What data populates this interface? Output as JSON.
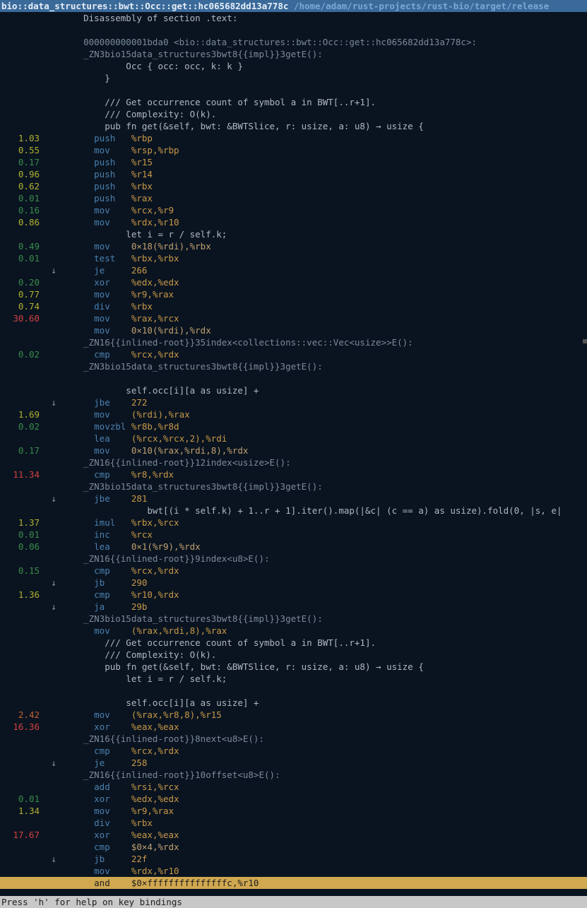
{
  "titlebar": {
    "func": "bio::data_structures::bwt::Occ::get::hc065682dd13a778c",
    "path": "/home/adam/rust-projects/rust-bio/target/release"
  },
  "statusbar": "Press 'h' for help on key bindings",
  "lines": [
    {
      "p": "",
      "j": "",
      "hl": false,
      "segs": [
        {
          "c": "src",
          "t": "    Disassembly of section .text:"
        }
      ]
    },
    {
      "p": "",
      "j": "",
      "hl": false,
      "segs": [
        {
          "c": "src",
          "t": ""
        }
      ]
    },
    {
      "p": "",
      "j": "",
      "hl": false,
      "segs": [
        {
          "c": "lbl",
          "t": "    000000000001bda0 <bio::data_structures::bwt::Occ::get::hc065682dd13a778c>:"
        }
      ]
    },
    {
      "p": "",
      "j": "",
      "hl": false,
      "segs": [
        {
          "c": "lbl",
          "t": "    _ZN3bio15data_structures3bwt8{{impl}}3getE():"
        }
      ]
    },
    {
      "p": "",
      "j": "",
      "hl": false,
      "segs": [
        {
          "c": "src",
          "t": "            Occ { occ: occ, k: k }"
        }
      ]
    },
    {
      "p": "",
      "j": "",
      "hl": false,
      "segs": [
        {
          "c": "src",
          "t": "        }"
        }
      ]
    },
    {
      "p": "",
      "j": "",
      "hl": false,
      "segs": [
        {
          "c": "src",
          "t": ""
        }
      ]
    },
    {
      "p": "",
      "j": "",
      "hl": false,
      "segs": [
        {
          "c": "src",
          "t": "        /// Get occurrence count of symbol a in BWT[..r+1]."
        }
      ]
    },
    {
      "p": "",
      "j": "",
      "hl": false,
      "segs": [
        {
          "c": "src",
          "t": "        /// Complexity: O(k)."
        }
      ]
    },
    {
      "p": "",
      "j": "",
      "hl": false,
      "segs": [
        {
          "c": "src",
          "t": "        pub fn get(&self, bwt: &BWTSlice, r: usize, a: u8) → usize {"
        }
      ]
    },
    {
      "p": "1.03",
      "pc": "pct-med",
      "j": "",
      "hl": false,
      "segs": [
        {
          "c": "mnem",
          "t": "      push   "
        },
        {
          "c": "reg",
          "t": "%rbp"
        }
      ]
    },
    {
      "p": "0.55",
      "pc": "pct-med",
      "j": "",
      "hl": false,
      "segs": [
        {
          "c": "mnem",
          "t": "      mov    "
        },
        {
          "c": "reg",
          "t": "%rsp,%rbp"
        }
      ]
    },
    {
      "p": "0.17",
      "pc": "pct-low",
      "j": "",
      "hl": false,
      "segs": [
        {
          "c": "mnem",
          "t": "      push   "
        },
        {
          "c": "reg",
          "t": "%r15"
        }
      ]
    },
    {
      "p": "0.96",
      "pc": "pct-med",
      "j": "",
      "hl": false,
      "segs": [
        {
          "c": "mnem",
          "t": "      push   "
        },
        {
          "c": "reg",
          "t": "%r14"
        }
      ]
    },
    {
      "p": "0.62",
      "pc": "pct-med",
      "j": "",
      "hl": false,
      "segs": [
        {
          "c": "mnem",
          "t": "      push   "
        },
        {
          "c": "reg",
          "t": "%rbx"
        }
      ]
    },
    {
      "p": "0.01",
      "pc": "pct-low",
      "j": "",
      "hl": false,
      "segs": [
        {
          "c": "mnem",
          "t": "      push   "
        },
        {
          "c": "reg",
          "t": "%rax"
        }
      ]
    },
    {
      "p": "0.16",
      "pc": "pct-low",
      "j": "",
      "hl": false,
      "segs": [
        {
          "c": "mnem",
          "t": "      mov    "
        },
        {
          "c": "reg",
          "t": "%rcx,%r9"
        }
      ]
    },
    {
      "p": "0.86",
      "pc": "pct-med",
      "j": "",
      "hl": false,
      "segs": [
        {
          "c": "mnem",
          "t": "      mov    "
        },
        {
          "c": "reg",
          "t": "%rdx,%r10"
        }
      ]
    },
    {
      "p": "",
      "j": "",
      "hl": false,
      "segs": [
        {
          "c": "src",
          "t": "            let i = r / self.k;"
        }
      ]
    },
    {
      "p": "0.49",
      "pc": "pct-low",
      "j": "",
      "hl": false,
      "segs": [
        {
          "c": "mnem",
          "t": "      mov    "
        },
        {
          "c": "num",
          "t": "0×18(%rdi),%rbx"
        }
      ]
    },
    {
      "p": "0.01",
      "pc": "pct-low",
      "j": "",
      "hl": false,
      "segs": [
        {
          "c": "mnem",
          "t": "      test   "
        },
        {
          "c": "reg",
          "t": "%rbx,%rbx"
        }
      ]
    },
    {
      "p": "",
      "j": "↓",
      "hl": false,
      "segs": [
        {
          "c": "mnem",
          "t": "      je     "
        },
        {
          "c": "tgt",
          "t": "266"
        }
      ]
    },
    {
      "p": "0.20",
      "pc": "pct-low",
      "j": "",
      "hl": false,
      "segs": [
        {
          "c": "mnem",
          "t": "      xor    "
        },
        {
          "c": "reg",
          "t": "%edx,%edx"
        }
      ]
    },
    {
      "p": "0.77",
      "pc": "pct-med",
      "j": "",
      "hl": false,
      "segs": [
        {
          "c": "mnem",
          "t": "      mov    "
        },
        {
          "c": "reg",
          "t": "%r9,%rax"
        }
      ]
    },
    {
      "p": "0.74",
      "pc": "pct-med",
      "j": "",
      "hl": false,
      "segs": [
        {
          "c": "mnem",
          "t": "      div    "
        },
        {
          "c": "reg",
          "t": "%rbx"
        }
      ]
    },
    {
      "p": "30.60",
      "pc": "pct-hot",
      "j": "",
      "hl": false,
      "segs": [
        {
          "c": "mnem",
          "t": "      mov    "
        },
        {
          "c": "reg",
          "t": "%rax,%rcx"
        }
      ]
    },
    {
      "p": "",
      "j": "",
      "hl": false,
      "segs": [
        {
          "c": "mnem",
          "t": "      mov    "
        },
        {
          "c": "num",
          "t": "0×10(%rdi),%rdx"
        }
      ]
    },
    {
      "p": "",
      "j": "",
      "hl": false,
      "segs": [
        {
          "c": "lbl",
          "t": "    _ZN16{{inlined-root}}35index<collections::vec::Vec<usize>>E():"
        }
      ]
    },
    {
      "p": "0.02",
      "pc": "pct-low",
      "j": "",
      "hl": false,
      "segs": [
        {
          "c": "mnem",
          "t": "      cmp    "
        },
        {
          "c": "reg",
          "t": "%rcx,%rdx"
        }
      ]
    },
    {
      "p": "",
      "j": "",
      "hl": false,
      "segs": [
        {
          "c": "lbl",
          "t": "    _ZN3bio15data_structures3bwt8{{impl}}3getE():"
        }
      ]
    },
    {
      "p": "",
      "j": "",
      "hl": false,
      "segs": [
        {
          "c": "src",
          "t": ""
        }
      ]
    },
    {
      "p": "",
      "j": "",
      "hl": false,
      "segs": [
        {
          "c": "src",
          "t": "            self.occ[i][a as usize] +"
        }
      ]
    },
    {
      "p": "",
      "j": "↓",
      "hl": false,
      "segs": [
        {
          "c": "mnem",
          "t": "      jbe    "
        },
        {
          "c": "tgt",
          "t": "272"
        }
      ]
    },
    {
      "p": "1.69",
      "pc": "pct-med",
      "j": "",
      "hl": false,
      "segs": [
        {
          "c": "mnem",
          "t": "      mov    "
        },
        {
          "c": "reg",
          "t": "(%rdi),%rax"
        }
      ]
    },
    {
      "p": "0.02",
      "pc": "pct-low",
      "j": "",
      "hl": false,
      "segs": [
        {
          "c": "mnem",
          "t": "      movzbl "
        },
        {
          "c": "reg",
          "t": "%r8b,%r8d"
        }
      ]
    },
    {
      "p": "",
      "j": "",
      "hl": false,
      "segs": [
        {
          "c": "mnem",
          "t": "      lea    "
        },
        {
          "c": "reg",
          "t": "(%rcx,%rcx,2),%rdi"
        }
      ]
    },
    {
      "p": "0.17",
      "pc": "pct-low",
      "j": "",
      "hl": false,
      "segs": [
        {
          "c": "mnem",
          "t": "      mov    "
        },
        {
          "c": "num",
          "t": "0×10(%rax,%rdi,8),%rdx"
        }
      ]
    },
    {
      "p": "",
      "j": "",
      "hl": false,
      "segs": [
        {
          "c": "lbl",
          "t": "    _ZN16{{inlined-root}}12index<usize>E():"
        }
      ]
    },
    {
      "p": "11.34",
      "pc": "pct-hot",
      "j": "",
      "hl": false,
      "segs": [
        {
          "c": "mnem",
          "t": "      cmp    "
        },
        {
          "c": "reg",
          "t": "%r8,%rdx"
        }
      ]
    },
    {
      "p": "",
      "j": "",
      "hl": false,
      "segs": [
        {
          "c": "lbl",
          "t": "    _ZN3bio15data_structures3bwt8{{impl}}3getE():"
        }
      ]
    },
    {
      "p": "",
      "j": "↓",
      "hl": false,
      "segs": [
        {
          "c": "mnem",
          "t": "      jbe    "
        },
        {
          "c": "tgt",
          "t": "281"
        }
      ]
    },
    {
      "p": "",
      "j": "",
      "hl": false,
      "segs": [
        {
          "c": "src",
          "t": "                bwt[(i * self.k) + 1..r + 1].iter().map(|&c| (c == a) as usize).fold(0, |s, e|"
        }
      ]
    },
    {
      "p": "1.37",
      "pc": "pct-med",
      "j": "",
      "hl": false,
      "segs": [
        {
          "c": "mnem",
          "t": "      imul   "
        },
        {
          "c": "reg",
          "t": "%rbx,%rcx"
        }
      ]
    },
    {
      "p": "0.01",
      "pc": "pct-low",
      "j": "",
      "hl": false,
      "segs": [
        {
          "c": "mnem",
          "t": "      inc    "
        },
        {
          "c": "reg",
          "t": "%rcx"
        }
      ]
    },
    {
      "p": "0.06",
      "pc": "pct-low",
      "j": "",
      "hl": false,
      "segs": [
        {
          "c": "mnem",
          "t": "      lea    "
        },
        {
          "c": "num",
          "t": "0×1(%r9),%rdx"
        }
      ]
    },
    {
      "p": "",
      "j": "",
      "hl": false,
      "segs": [
        {
          "c": "lbl",
          "t": "    _ZN16{{inlined-root}}9index<u8>E():"
        }
      ]
    },
    {
      "p": "0.15",
      "pc": "pct-low",
      "j": "",
      "hl": false,
      "segs": [
        {
          "c": "mnem",
          "t": "      cmp    "
        },
        {
          "c": "reg",
          "t": "%rcx,%rdx"
        }
      ]
    },
    {
      "p": "",
      "j": "↓",
      "hl": false,
      "segs": [
        {
          "c": "mnem",
          "t": "      jb     "
        },
        {
          "c": "tgt",
          "t": "290"
        }
      ]
    },
    {
      "p": "1.36",
      "pc": "pct-med",
      "j": "",
      "hl": false,
      "segs": [
        {
          "c": "mnem",
          "t": "      cmp    "
        },
        {
          "c": "reg",
          "t": "%r10,%rdx"
        }
      ]
    },
    {
      "p": "",
      "j": "↓",
      "hl": false,
      "segs": [
        {
          "c": "mnem",
          "t": "      ja     "
        },
        {
          "c": "tgt",
          "t": "29b"
        }
      ]
    },
    {
      "p": "",
      "j": "",
      "hl": false,
      "segs": [
        {
          "c": "lbl",
          "t": "    _ZN3bio15data_structures3bwt8{{impl}}3getE():"
        }
      ]
    },
    {
      "p": "",
      "j": "",
      "hl": false,
      "segs": [
        {
          "c": "mnem",
          "t": "      mov    "
        },
        {
          "c": "reg",
          "t": "(%rax,%rdi,8),%rax"
        }
      ]
    },
    {
      "p": "",
      "j": "",
      "hl": false,
      "segs": [
        {
          "c": "src",
          "t": "        /// Get occurrence count of symbol a in BWT[..r+1]."
        }
      ]
    },
    {
      "p": "",
      "j": "",
      "hl": false,
      "segs": [
        {
          "c": "src",
          "t": "        /// Complexity: O(k)."
        }
      ]
    },
    {
      "p": "",
      "j": "",
      "hl": false,
      "segs": [
        {
          "c": "src",
          "t": "        pub fn get(&self, bwt: &BWTSlice, r: usize, a: u8) → usize {"
        }
      ]
    },
    {
      "p": "",
      "j": "",
      "hl": false,
      "segs": [
        {
          "c": "src",
          "t": "            let i = r / self.k;"
        }
      ]
    },
    {
      "p": "",
      "j": "",
      "hl": false,
      "segs": [
        {
          "c": "src",
          "t": ""
        }
      ]
    },
    {
      "p": "",
      "j": "",
      "hl": false,
      "segs": [
        {
          "c": "src",
          "t": "            self.occ[i][a as usize] +"
        }
      ]
    },
    {
      "p": "2.42",
      "pc": "pct-high",
      "j": "",
      "hl": false,
      "segs": [
        {
          "c": "mnem",
          "t": "      mov    "
        },
        {
          "c": "reg",
          "t": "(%rax,%r8,8),%r15"
        }
      ]
    },
    {
      "p": "16.36",
      "pc": "pct-hot",
      "j": "",
      "hl": false,
      "segs": [
        {
          "c": "mnem",
          "t": "      xor    "
        },
        {
          "c": "reg",
          "t": "%eax,%eax"
        }
      ]
    },
    {
      "p": "",
      "j": "",
      "hl": false,
      "segs": [
        {
          "c": "lbl",
          "t": "    _ZN16{{inlined-root}}8next<u8>E():"
        }
      ]
    },
    {
      "p": "",
      "j": "",
      "hl": false,
      "segs": [
        {
          "c": "mnem",
          "t": "      cmp    "
        },
        {
          "c": "reg",
          "t": "%rcx,%rdx"
        }
      ]
    },
    {
      "p": "",
      "j": "↓",
      "hl": false,
      "segs": [
        {
          "c": "mnem",
          "t": "      je     "
        },
        {
          "c": "tgt",
          "t": "258"
        }
      ]
    },
    {
      "p": "",
      "j": "",
      "hl": false,
      "segs": [
        {
          "c": "lbl",
          "t": "    _ZN16{{inlined-root}}10offset<u8>E():"
        }
      ]
    },
    {
      "p": "",
      "j": "",
      "hl": false,
      "segs": [
        {
          "c": "mnem",
          "t": "      add    "
        },
        {
          "c": "reg",
          "t": "%rsi,%rcx"
        }
      ]
    },
    {
      "p": "0.01",
      "pc": "pct-low",
      "j": "",
      "hl": false,
      "segs": [
        {
          "c": "mnem",
          "t": "      xor    "
        },
        {
          "c": "reg",
          "t": "%edx,%edx"
        }
      ]
    },
    {
      "p": "1.34",
      "pc": "pct-med",
      "j": "",
      "hl": false,
      "segs": [
        {
          "c": "mnem",
          "t": "      mov    "
        },
        {
          "c": "reg",
          "t": "%r9,%rax"
        }
      ]
    },
    {
      "p": "",
      "j": "",
      "hl": false,
      "segs": [
        {
          "c": "mnem",
          "t": "      div    "
        },
        {
          "c": "reg",
          "t": "%rbx"
        }
      ]
    },
    {
      "p": "17.67",
      "pc": "pct-hot",
      "j": "",
      "hl": false,
      "segs": [
        {
          "c": "mnem",
          "t": "      xor    "
        },
        {
          "c": "reg",
          "t": "%eax,%eax"
        }
      ]
    },
    {
      "p": "",
      "j": "",
      "hl": false,
      "segs": [
        {
          "c": "mnem",
          "t": "      cmp    "
        },
        {
          "c": "num",
          "t": "$0×4,%rdx"
        }
      ]
    },
    {
      "p": "",
      "j": "↓",
      "hl": false,
      "segs": [
        {
          "c": "mnem",
          "t": "      jb     "
        },
        {
          "c": "tgt",
          "t": "22f"
        }
      ]
    },
    {
      "p": "",
      "j": "",
      "hl": false,
      "segs": [
        {
          "c": "mnem",
          "t": "      mov    "
        },
        {
          "c": "reg",
          "t": "%rdx,%r10"
        }
      ]
    },
    {
      "p": "",
      "j": "",
      "hl": true,
      "segs": [
        {
          "c": "mnem",
          "t": "      and    "
        },
        {
          "c": "num",
          "t": "$0×fffffffffffffffc,%r10"
        }
      ]
    }
  ]
}
